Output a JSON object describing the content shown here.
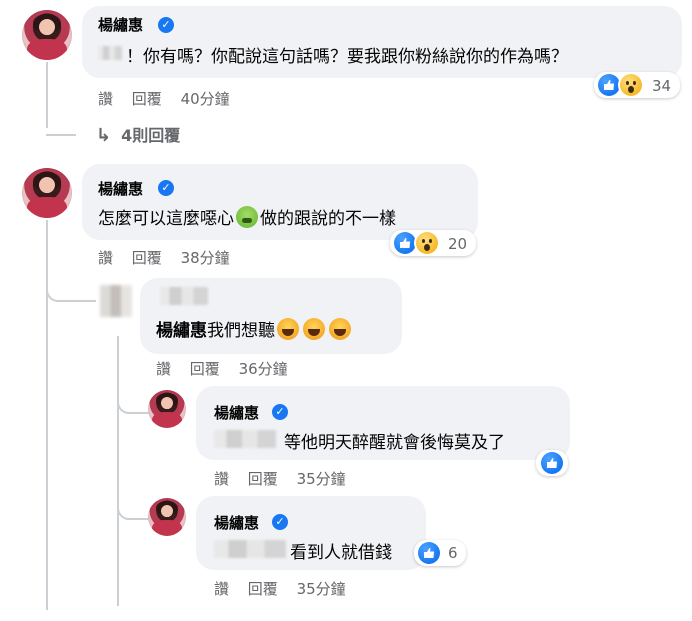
{
  "comments": [
    {
      "author": "楊繡惠",
      "text": "！你有嗎？你配說這句話嗎？要我跟你粉絲說你的作為嗎？",
      "reaction_count": "34",
      "like_label": "讚",
      "reply_label": "回覆",
      "time": "40分鐘",
      "replies_toggle": "4則回覆"
    },
    {
      "author": "楊繡惠",
      "text_before": "怎麼可以這麼噁心",
      "text_after": "做的跟說的不一樣",
      "reaction_count": "20",
      "like_label": "讚",
      "reply_label": "回覆",
      "time": "38分鐘"
    }
  ],
  "replies": [
    {
      "mention": "楊繡惠",
      "text": "我們想聽",
      "like_label": "讚",
      "reply_label": "回覆",
      "time": "36分鐘"
    },
    {
      "author": "楊繡惠",
      "text": "等他明天醉醒就會後悔莫及了",
      "like_label": "讚",
      "reply_label": "回覆",
      "time": "35分鐘"
    },
    {
      "author": "楊繡惠",
      "text": "看到人就借錢",
      "reaction_count": "6",
      "like_label": "讚",
      "reply_label": "回覆",
      "time": "35分鐘"
    }
  ],
  "icons": {
    "verified": "verified-badge-icon",
    "like": "like-reaction-icon",
    "wow": "wow-reaction-icon",
    "reply_arrow": "reply-arrow-icon"
  },
  "colors": {
    "accent": "#1877f2",
    "bubble": "#f0f2f5",
    "secondary_text": "#65676b"
  }
}
